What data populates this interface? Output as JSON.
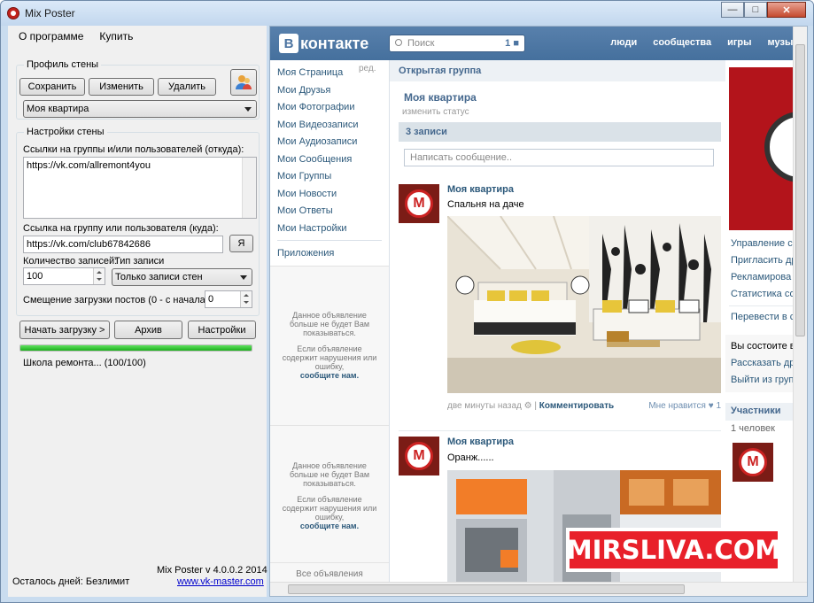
{
  "window": {
    "title": "Mix Poster",
    "colors": {
      "accent": "#4c74a1",
      "progress": "#1eb01e",
      "banner": "#e8202a"
    }
  },
  "menu": {
    "about": "О программе",
    "buy": "Купить"
  },
  "profile": {
    "group_title": "Профиль стены",
    "save": "Сохранить",
    "edit": "Изменить",
    "delete": "Удалить",
    "selected": "Моя квартира",
    "icon": "user-icon"
  },
  "settings": {
    "group_title": "Настройки стены",
    "from_label": "Ссылки на группы и/или пользователей (откуда):",
    "from_value": "https://vk.com/allremont4you",
    "to_label": "Ссылка на группу или пользователя (куда):",
    "to_value": "https://vk.com/club67842686",
    "me_button": "Я",
    "count_label": "Количество записей:",
    "type_label": "Тип записи",
    "count_value": "100",
    "type_value": "Только записи стен",
    "offset_label": "Смещение загрузки постов (0 - с начала):",
    "offset_value": "0"
  },
  "actions": {
    "start": "Начать загрузку >",
    "archive": "Архив",
    "settings": "Настройки"
  },
  "progress": {
    "value": 1.0,
    "status": "Школа ремонта... (100/100)"
  },
  "footer": {
    "version": "Mix Poster v 4.0.0.2 2014",
    "days_left": "Осталось дней: Безлимит",
    "site": "www.vk-master.com"
  },
  "vk": {
    "logo_letter": "В",
    "logo_text": "контакте",
    "search_placeholder": "Поиск",
    "notif_count": "1",
    "nav": [
      "люди",
      "сообщества",
      "игры",
      "музыка"
    ],
    "menu": [
      "Моя Страница",
      "Мои Друзья",
      "Мои Фотографии",
      "Мои Видеозаписи",
      "Мои Аудиозаписи",
      "Мои Сообщения",
      "Мои Группы",
      "Мои Новости",
      "Мои Ответы",
      "Мои Настройки"
    ],
    "menu_edit": "ред.",
    "apps": "Приложения",
    "ad1_text1": "Данное объявление больше не будет Вам показываться.",
    "ad1_text2": "Если объявление содержит нарушения или ошибку,",
    "ad1_link": "сообщите нам.",
    "all_ads": "Все объявления",
    "breadcrumb": "Открытая группа",
    "group_name": "Моя квартира",
    "change_status": "изменить статус",
    "wall_count": "3 записи",
    "post_placeholder": "Написать сообщение..",
    "posts": [
      {
        "author": "Моя квартира",
        "text": "Спальня на даче",
        "time": "две минуты назад",
        "comment": "Комментировать",
        "likes": "Мне нравится",
        "like_count": "1"
      },
      {
        "author": "Моя квартира",
        "text": "Оранж......"
      }
    ],
    "right_links": [
      "Управление со",
      "Пригласить др",
      "Рекламирова",
      "Статистика со"
    ],
    "transfer": "Перевести в с",
    "member_status": "Вы состоите в",
    "tell_friends": "Рассказать др",
    "leave": "Выйти из груп",
    "members_title": "Участники",
    "members_count": "1 человек"
  },
  "watermark": "MIRSLIVA.COM"
}
